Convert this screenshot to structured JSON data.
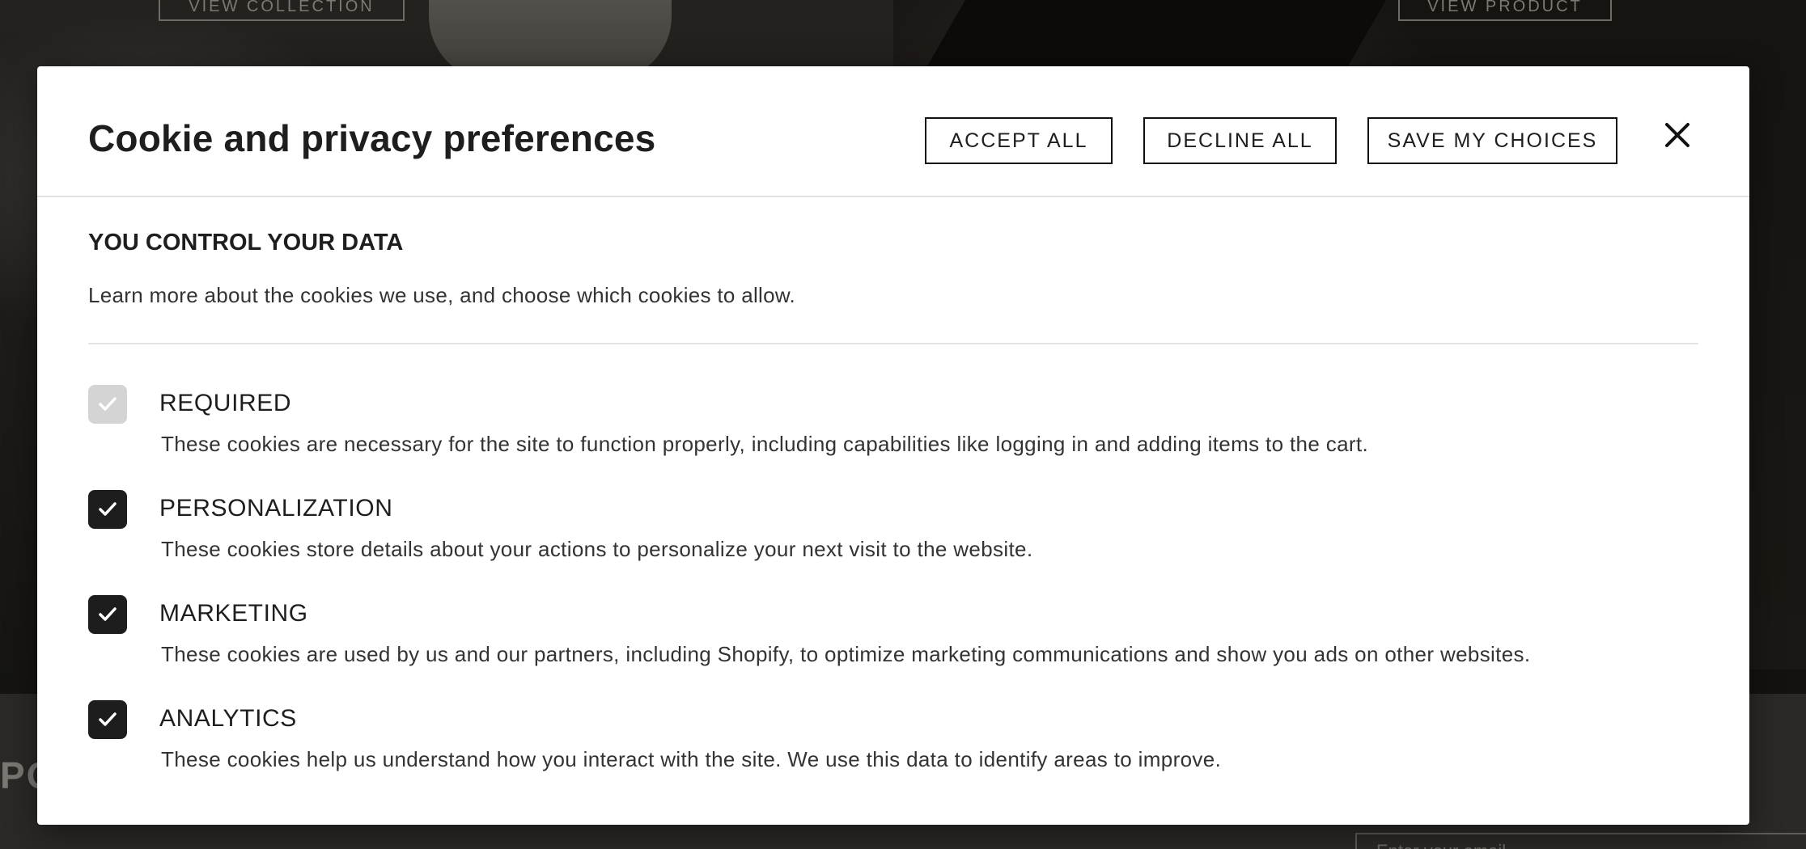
{
  "background": {
    "view_collection_label": "VIEW COLLECTION",
    "view_product_label": "VIEW PRODUCT",
    "footer_word": "PO",
    "email_placeholder": "Enter your email"
  },
  "modal": {
    "title": "Cookie and privacy preferences",
    "buttons": {
      "accept_all": "ACCEPT ALL",
      "decline_all": "DECLINE ALL",
      "save_choices": "SAVE MY CHOICES"
    },
    "close_icon": "close-icon",
    "section": {
      "heading": "YOU CONTROL YOUR DATA",
      "description": "Learn more about the cookies we use, and choose which cookies to allow."
    },
    "categories": [
      {
        "title": "REQUIRED",
        "description": "These cookies are necessary for the site to function properly, including capabilities like logging in and adding items to the cart.",
        "checked": true,
        "disabled": true
      },
      {
        "title": "PERSONALIZATION",
        "description": "These cookies store details about your actions to personalize your next visit to the website.",
        "checked": true,
        "disabled": false
      },
      {
        "title": "MARKETING",
        "description": "These cookies are used by us and our partners, including Shopify, to optimize marketing communications and show you ads on other websites.",
        "checked": true,
        "disabled": false
      },
      {
        "title": "ANALYTICS",
        "description": "These cookies help us understand how you interact with the site. We use this data to identify areas to improve.",
        "checked": true,
        "disabled": false
      }
    ]
  },
  "colors": {
    "checkbox_checked": "#1d1d1d",
    "checkbox_disabled": "#d4d4d4",
    "overlay_dark": "#141210"
  }
}
